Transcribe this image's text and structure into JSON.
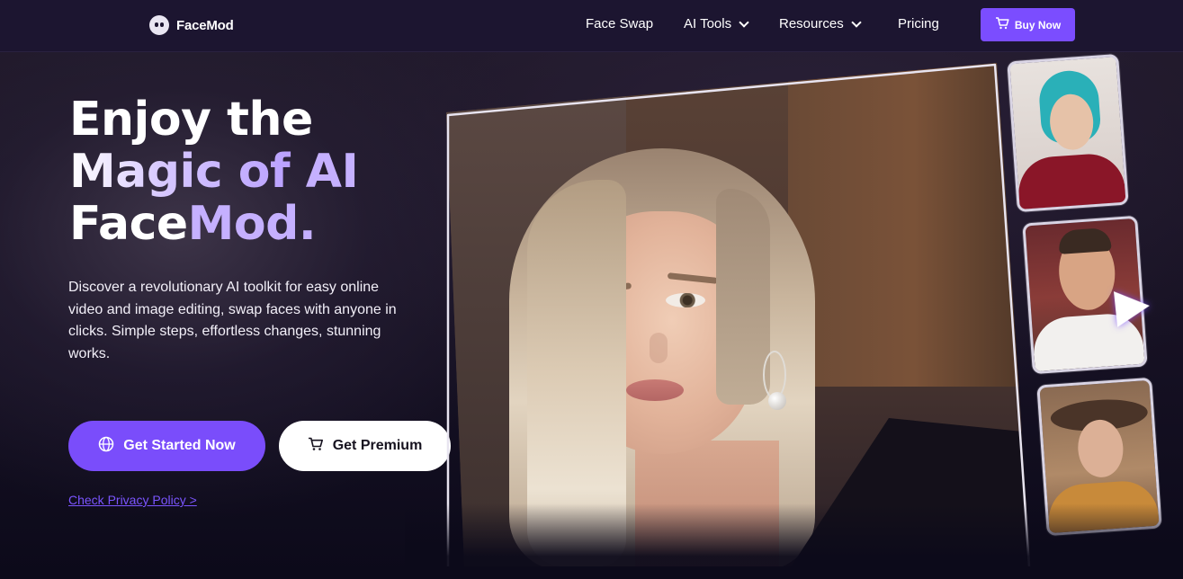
{
  "nav": {
    "logo_text": "FaceMod",
    "items": [
      {
        "label": "Face Swap"
      },
      {
        "label": "AI Tools"
      },
      {
        "label": "Resources"
      },
      {
        "label": "Pricing"
      }
    ],
    "buy_label": "Buy Now"
  },
  "hero": {
    "headline": {
      "line1": "Enjoy the",
      "line2_a": "Magic of ",
      "line2_b": "AI",
      "line3_a": "Face",
      "line3_b": "Mod."
    },
    "description": "Discover a revolutionary AI toolkit for easy online video and image editing, swap faces with anyone in clicks. Simple steps, effortless changes, stunning works.",
    "primary_cta": "Get Started Now",
    "secondary_cta": "Get Premium",
    "privacy_link": "Check Privacy Policy >"
  },
  "colors": {
    "accent": "#7a4dfb",
    "nav_bg": "#1c1530",
    "link": "#7b55ff"
  },
  "icons": {
    "logo": "facemod-logo-icon",
    "cart": "cart-icon",
    "globe": "globe-icon",
    "chevron": "chevron-down-icon",
    "play": "play-icon"
  }
}
